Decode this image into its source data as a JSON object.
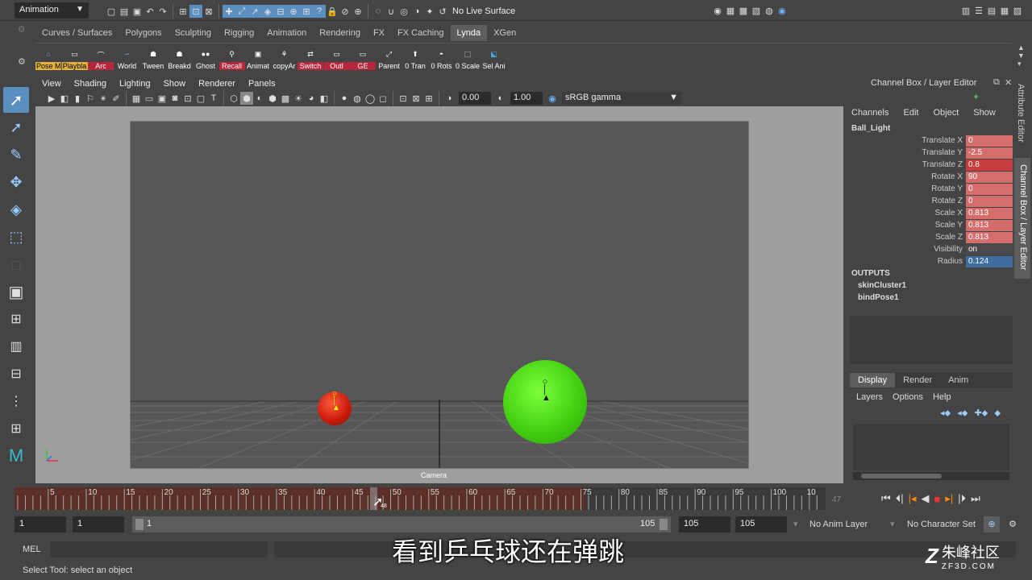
{
  "top": {
    "mode": "Animation",
    "live_surface": "No Live Surface"
  },
  "shelf_tabs": [
    "Curves / Surfaces",
    "Polygons",
    "Sculpting",
    "Rigging",
    "Animation",
    "Rendering",
    "FX",
    "FX Caching",
    "Lynda",
    "XGen"
  ],
  "shelf_buttons": [
    {
      "label": "Pose M",
      "style": "ye"
    },
    {
      "label": "Playbla",
      "style": "ye"
    },
    {
      "label": "Arc",
      "style": "hl"
    },
    {
      "label": "World",
      "style": ""
    },
    {
      "label": "Tween",
      "style": ""
    },
    {
      "label": "Breakd",
      "style": ""
    },
    {
      "label": "Ghost",
      "style": ""
    },
    {
      "label": "Recall",
      "style": "hl"
    },
    {
      "label": "Animat",
      "style": ""
    },
    {
      "label": "copyAr",
      "style": ""
    },
    {
      "label": "Switch",
      "style": "hl"
    },
    {
      "label": "Outl",
      "style": "hl"
    },
    {
      "label": "GE",
      "style": "hl"
    },
    {
      "label": "Parent",
      "style": ""
    },
    {
      "label": "0 Tran",
      "style": ""
    },
    {
      "label": "0 Rots",
      "style": ""
    },
    {
      "label": "0 Scale",
      "style": ""
    },
    {
      "label": "Sel Ani",
      "style": ""
    }
  ],
  "viewport": {
    "menus": [
      "View",
      "Shading",
      "Lighting",
      "Show",
      "Renderer",
      "Panels"
    ],
    "near": "0.00",
    "far": "1.00",
    "color_space": "sRGB gamma",
    "camera_label": "Camera"
  },
  "channel_box": {
    "title": "Channel Box / Layer Editor",
    "menus": [
      "Channels",
      "Edit",
      "Object",
      "Show"
    ],
    "object": "Ball_Light",
    "attributes": [
      {
        "name": "Translate X",
        "value": "0",
        "style": ""
      },
      {
        "name": "Translate Y",
        "value": "-2.5",
        "style": ""
      },
      {
        "name": "Translate Z",
        "value": "0.8",
        "style": "sel"
      },
      {
        "name": "Rotate X",
        "value": "90",
        "style": ""
      },
      {
        "name": "Rotate Y",
        "value": "0",
        "style": ""
      },
      {
        "name": "Rotate Z",
        "value": "0",
        "style": ""
      },
      {
        "name": "Scale X",
        "value": "0.813",
        "style": ""
      },
      {
        "name": "Scale Y",
        "value": "0.813",
        "style": ""
      },
      {
        "name": "Scale Z",
        "value": "0.813",
        "style": ""
      },
      {
        "name": "Visibility",
        "value": "on",
        "style": "plain"
      },
      {
        "name": "Radius",
        "value": "0.124",
        "style": "blue"
      }
    ],
    "outputs_label": "OUTPUTS",
    "outputs": [
      "skinCluster1",
      "bindPose1"
    ],
    "layer_tabs": [
      "Display",
      "Render",
      "Anim"
    ],
    "layer_menus": [
      "Layers",
      "Options",
      "Help"
    ]
  },
  "side_tabs": [
    "Attribute Editor",
    "Channel Box / Layer Editor"
  ],
  "timeline": {
    "ticks": [
      "5",
      "10",
      "15",
      "20",
      "25",
      "30",
      "35",
      "40",
      "45",
      "50",
      "55",
      "60",
      "65",
      "70",
      "75",
      "80",
      "85",
      "90",
      "95",
      "100",
      "10"
    ],
    "current_frame": "47",
    "cursor_frame": "48"
  },
  "range": {
    "start": "1",
    "inner_start": "1",
    "slider_start": "1",
    "slider_end": "105",
    "inner_end": "105",
    "end": "105",
    "anim_layer": "No Anim Layer",
    "char_set": "No Character Set"
  },
  "mel_label": "MEL",
  "help_text": "Select Tool: select an object",
  "subtitle": "看到乒乓球还在弹跳",
  "watermark": {
    "line1": "朱峰社区",
    "line2": "ZF3D.COM"
  }
}
